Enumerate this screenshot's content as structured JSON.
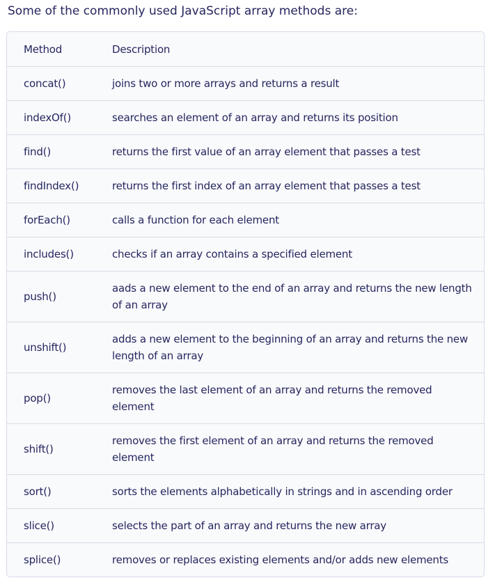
{
  "intro": "Some of the commonly used JavaScript array methods are:",
  "table": {
    "headers": [
      "Method",
      "Description"
    ],
    "rows": [
      {
        "method": "concat()",
        "description": "joins two or more arrays and returns a result"
      },
      {
        "method": "indexOf()",
        "description": "searches an element of an array and returns its position"
      },
      {
        "method": "find()",
        "description": "returns the first value of an array element that passes a test"
      },
      {
        "method": "findIndex()",
        "description": "returns the first index of an array element that passes a test"
      },
      {
        "method": "forEach()",
        "description": "calls a function for each element"
      },
      {
        "method": "includes()",
        "description": "checks if an array contains a specified element"
      },
      {
        "method": "push()",
        "description": "aads a new element to the end of an array and returns the new length of an array"
      },
      {
        "method": "unshift()",
        "description": "adds a new element to the beginning of an array and returns the new length of an array"
      },
      {
        "method": "pop()",
        "description": "removes the last element of an array and returns the removed element"
      },
      {
        "method": "shift()",
        "description": "removes the first element of an array and returns the removed element"
      },
      {
        "method": "sort()",
        "description": "sorts the elements alphabetically in strings and in ascending order"
      },
      {
        "method": "slice()",
        "description": "selects the part of an array and returns the new array"
      },
      {
        "method": "splice()",
        "description": "removes or replaces existing elements and/or adds new elements"
      }
    ]
  }
}
